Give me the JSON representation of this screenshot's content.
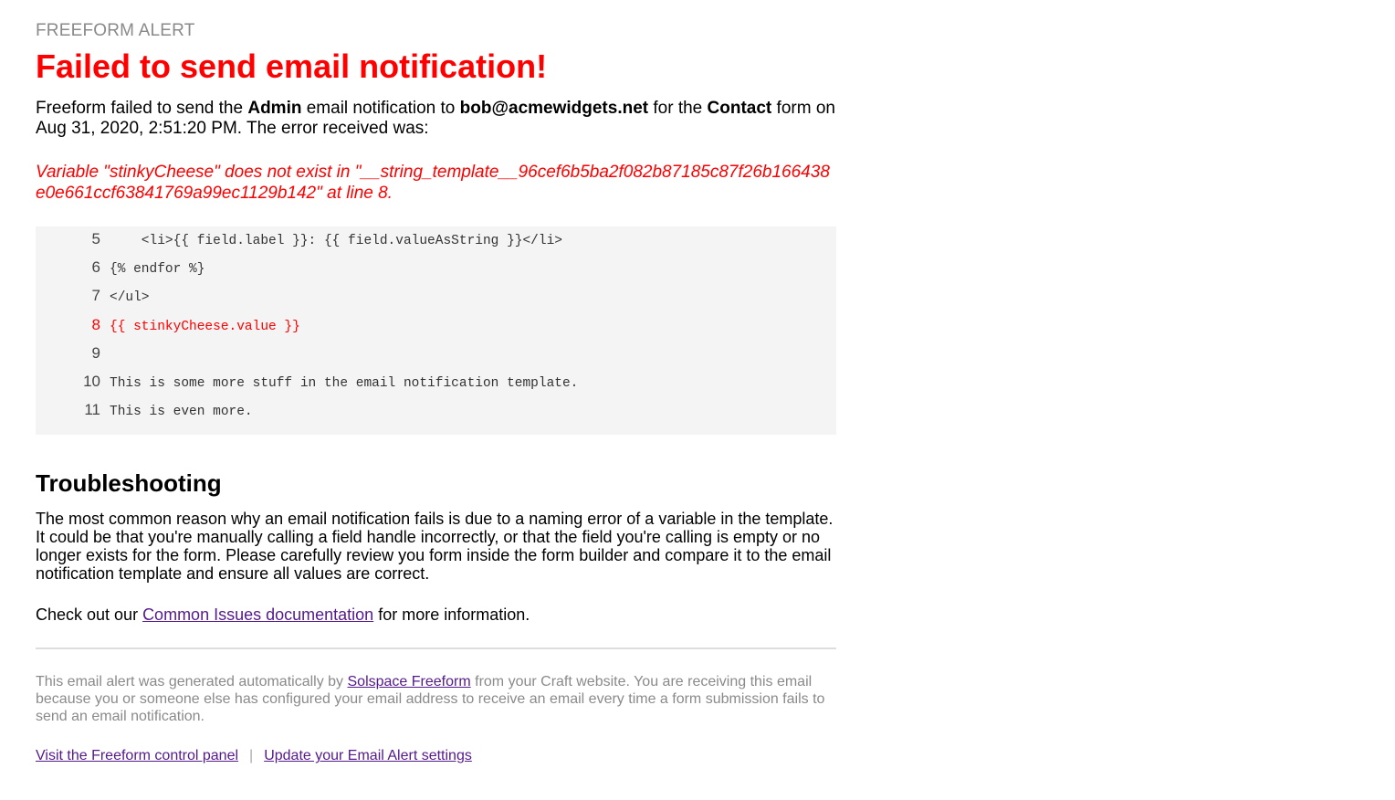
{
  "header": {
    "eyebrow": "FREEFORM ALERT",
    "title": "Failed to send email notification!"
  },
  "intro": {
    "part1": "Freeform failed to send the ",
    "notification_name": "Admin",
    "part2": " email notification to ",
    "recipient": "bob@acmewidgets.net",
    "part3": " for the ",
    "form_name": "Contact",
    "part4": " form on Aug 31, 2020, 2:51:20 PM. The error received was:"
  },
  "error": {
    "message": "Variable \"stinkyCheese\" does not exist in \"__string_template__96cef6b5ba2f082b87185c87f26b166438e0e661ccf63841769a99ec1129b142\" at line 8."
  },
  "code": {
    "lines": [
      {
        "num": "5",
        "text": "    <li>{{ field.label }}: {{ field.valueAsString }}</li>"
      },
      {
        "num": "6",
        "text": "{% endfor %}"
      },
      {
        "num": "7",
        "text": "</ul>"
      },
      {
        "num": "8",
        "text": "{{ stinkyCheese.value }}"
      },
      {
        "num": "9",
        "text": ""
      },
      {
        "num": "10",
        "text": "This is some more stuff in the email notification template."
      },
      {
        "num": "11",
        "text": "This is even more."
      }
    ],
    "error_line": "8",
    "error_color": "#ff0000"
  },
  "troubleshooting": {
    "title": "Troubleshooting",
    "body": "The most common reason why an email notification fails is due to a naming error of a variable in the template. It could be that you're manually calling a field handle incorrectly, or that the field you're calling is empty or no longer exists for the form. Please carefully review you form inside the form builder and compare it to the email notification template and ensure all values are correct.",
    "more_prefix": "Check out our ",
    "more_link": "Common Issues documentation",
    "more_suffix": " for more information."
  },
  "footer": {
    "text_prefix": "This email alert was generated automatically by ",
    "text_link": "Solspace Freeform",
    "text_suffix": " from your Craft website. You are receiving this email because you or someone else has configured your email address to receive an email every time a form submission fails to send an email notification.",
    "link_control_panel": "Visit the Freeform control panel",
    "separator": "|",
    "link_settings": "Update your Email Alert settings"
  },
  "colors": {
    "accent": "#ff0000",
    "muted": "#8a8a8a",
    "link": "#551a8b",
    "code_bg": "#f4f4f4"
  }
}
